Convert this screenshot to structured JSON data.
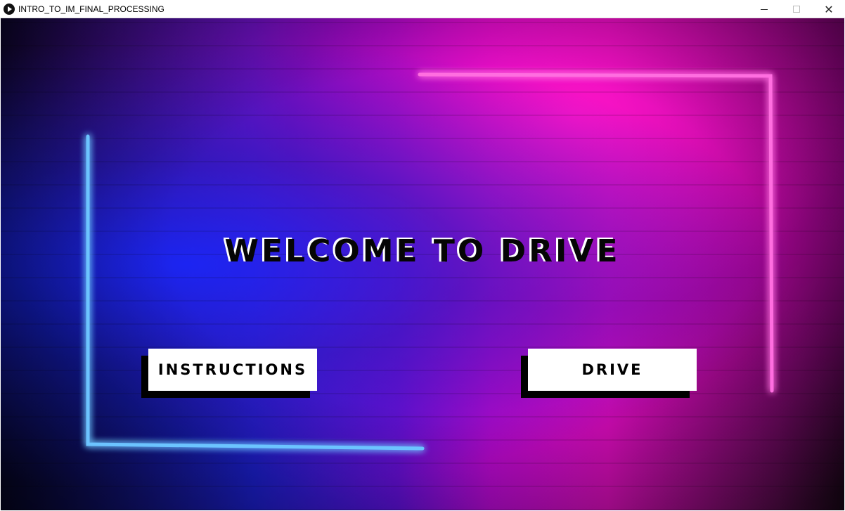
{
  "window": {
    "title": "INTRO_TO_IM_FINAL_PROCESSING",
    "close_glyph": "✕"
  },
  "screen": {
    "heading": "WELCOME TO DRIVE",
    "buttons": {
      "instructions_label": "INSTRUCTIONS",
      "drive_label": "DRIVE"
    }
  },
  "colors": {
    "neon_blue": "#3fa8ff",
    "neon_pink": "#ff4fd8",
    "button_bg": "#ffffff",
    "button_shadow": "#000000"
  }
}
